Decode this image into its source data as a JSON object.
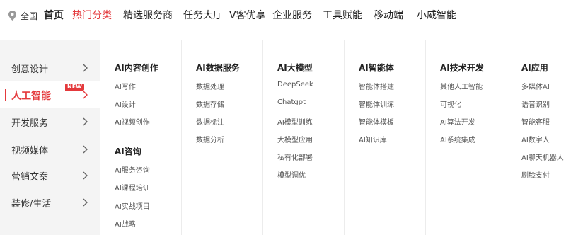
{
  "location": {
    "icon": "location-pin-icon",
    "label": "全国"
  },
  "nav": [
    {
      "label": "首页",
      "home": true
    },
    {
      "label": "热门分类",
      "active": true
    },
    {
      "label": "精选服务商"
    },
    {
      "label": "任务大厅"
    },
    {
      "label": "V客优享"
    },
    {
      "label": "企业服务"
    },
    {
      "label": "工具赋能"
    },
    {
      "label": "移动端"
    },
    {
      "label": "小威智能"
    }
  ],
  "sidebar": {
    "items": [
      {
        "label": "创意设计"
      },
      {
        "label": "人工智能",
        "active": true,
        "badge": "NEW"
      },
      {
        "label": "开发服务"
      },
      {
        "label": "视频媒体"
      },
      {
        "label": "营销文案"
      },
      {
        "label": "装修/生活"
      }
    ]
  },
  "menu": {
    "columns": [
      {
        "groups": [
          {
            "title": "AI内容创作",
            "items": [
              "AI写作",
              "AI设计",
              "AI视频创作"
            ]
          },
          {
            "title": "AI咨询",
            "items": [
              "AI服务咨询",
              "AI课程培训",
              "AI实战项目",
              "AI战略"
            ]
          }
        ]
      },
      {
        "groups": [
          {
            "title": "AI数据服务",
            "items": [
              "数据处理",
              "数据存储",
              "数据标注",
              "数据分析"
            ]
          }
        ]
      },
      {
        "groups": [
          {
            "title": "AI大模型",
            "items": [
              "DeepSeek",
              "Chatgpt",
              "AI模型训练",
              "大模型应用",
              "私有化部署",
              "模型调优"
            ]
          }
        ]
      },
      {
        "groups": [
          {
            "title": "AI智能体",
            "items": [
              "智能体搭建",
              "智能体训练",
              "智能体模板",
              "AI知识库"
            ]
          }
        ]
      },
      {
        "groups": [
          {
            "title": "AI技术开发",
            "items": [
              "其他人工智能",
              "可视化",
              "AI算法开发",
              "AI系统集成"
            ]
          }
        ]
      },
      {
        "groups": [
          {
            "title": "AI应用",
            "items": [
              "多媒体AI",
              "语音识别",
              "智能客服",
              "AI数字人",
              "AI聊天机器人",
              "刷脸支付"
            ]
          }
        ]
      }
    ]
  },
  "colors": {
    "accent": "#e4393c",
    "sidebar_bg": "#f4f4f4",
    "divider": "#ececec"
  }
}
